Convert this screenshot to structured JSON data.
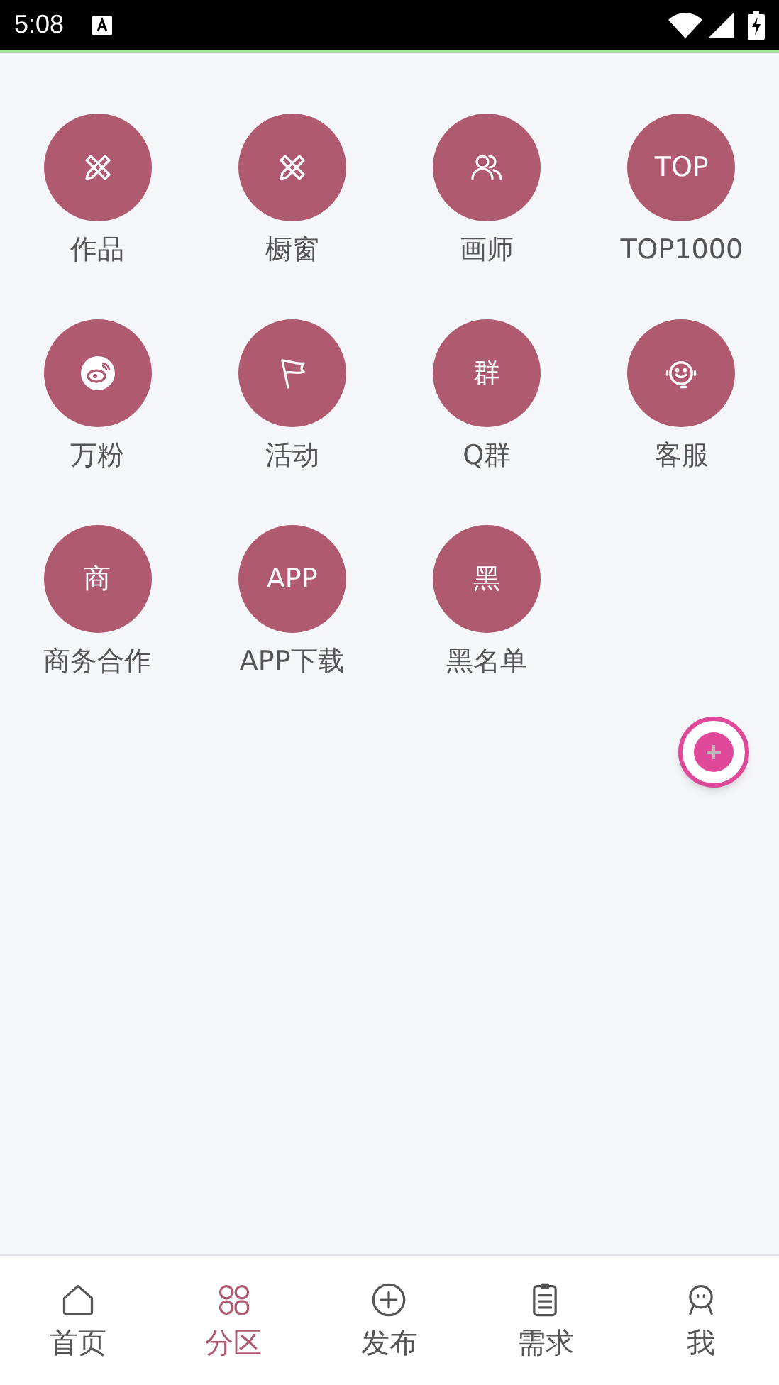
{
  "status_bar": {
    "time": "5:08"
  },
  "tiles": [
    {
      "label": "作品",
      "kind": "icon"
    },
    {
      "label": "橱窗",
      "kind": "icon"
    },
    {
      "label": "画师",
      "kind": "icon"
    },
    {
      "label": "TOP1000",
      "kind": "text",
      "text": "TOP"
    },
    {
      "label": "万粉",
      "kind": "icon"
    },
    {
      "label": "活动",
      "kind": "icon"
    },
    {
      "label": "Q群",
      "kind": "text",
      "text": "群"
    },
    {
      "label": "客服",
      "kind": "icon"
    },
    {
      "label": "商务合作",
      "kind": "text",
      "text": "商"
    },
    {
      "label": "APP下载",
      "kind": "text",
      "text": "APP"
    },
    {
      "label": "黑名单",
      "kind": "text",
      "text": "黑"
    }
  ],
  "nav": [
    {
      "label": "首页",
      "selected": false
    },
    {
      "label": "分区",
      "selected": true
    },
    {
      "label": "发布",
      "selected": false
    },
    {
      "label": "需求",
      "selected": false
    },
    {
      "label": "我",
      "selected": false
    }
  ]
}
